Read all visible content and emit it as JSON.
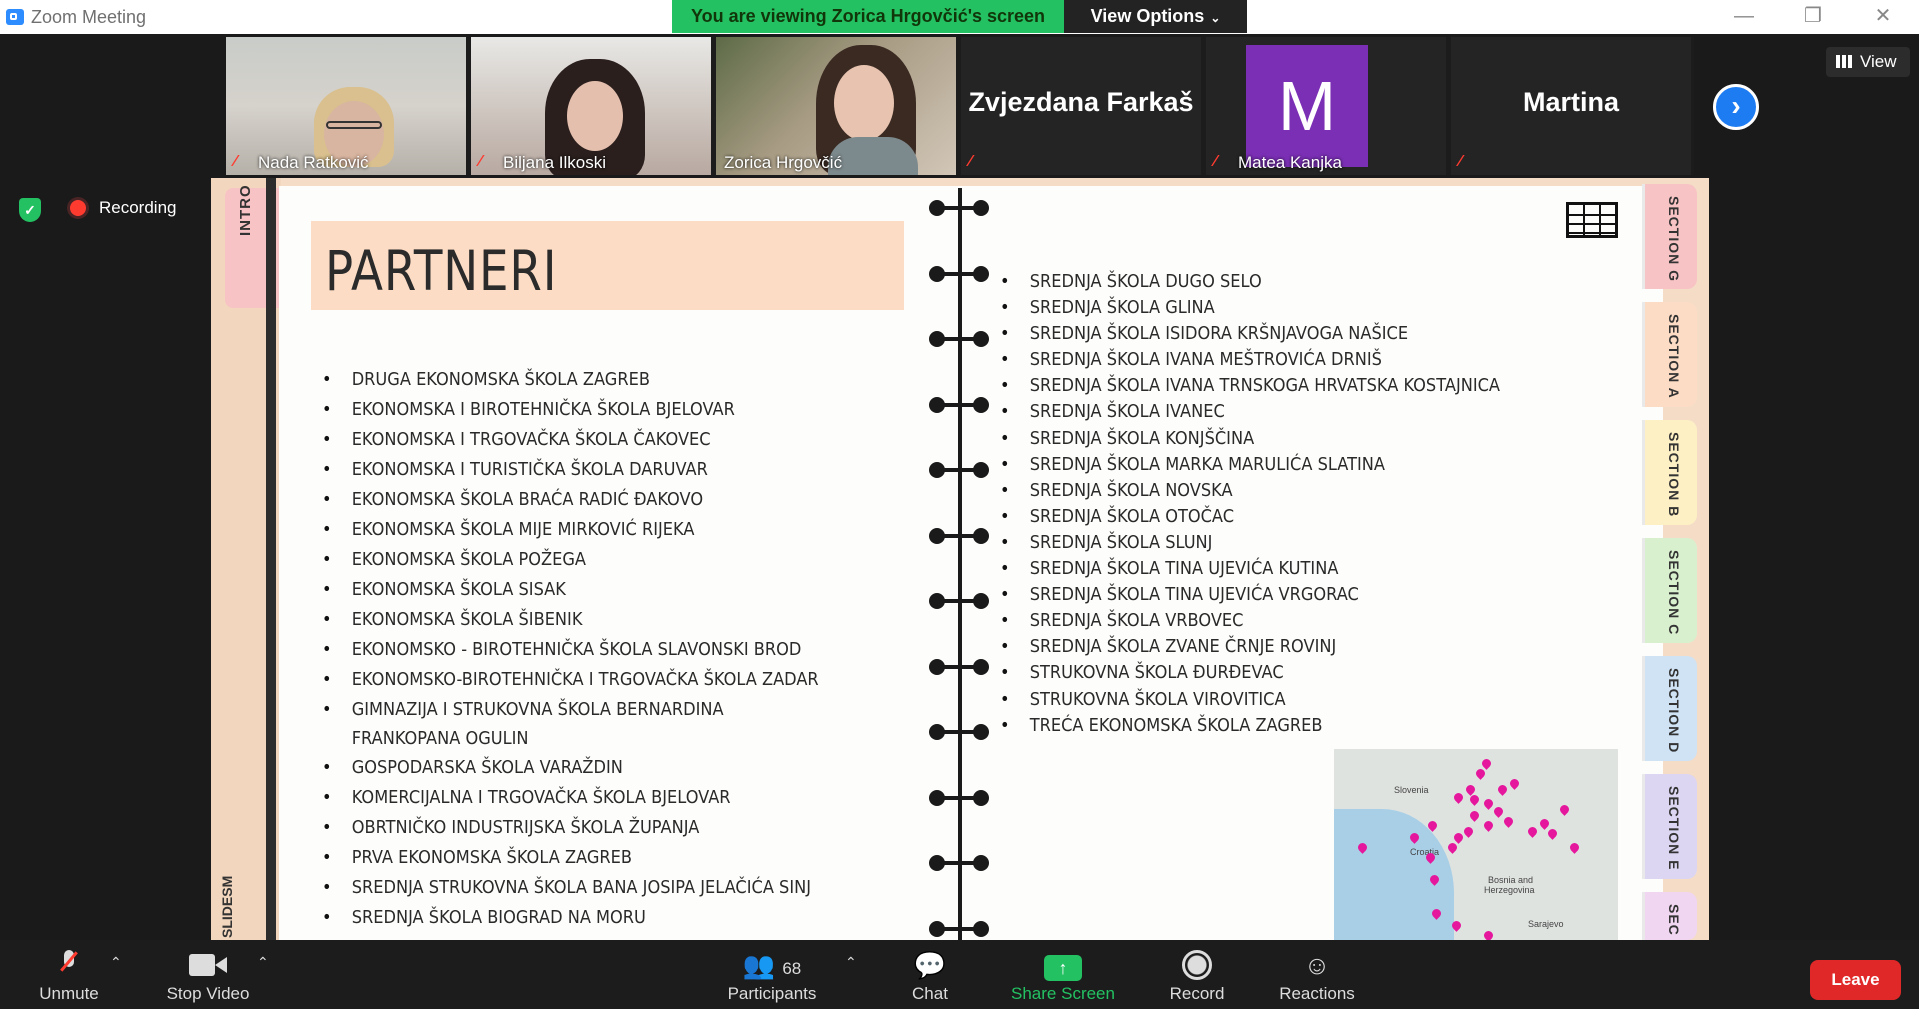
{
  "window": {
    "title": "Zoom Meeting",
    "minimize": "—",
    "maximize": "❐",
    "close": "✕"
  },
  "banner": {
    "viewing": "You are viewing Zorica Hrgovčić's screen",
    "view_options": "View Options",
    "caret": "⌄"
  },
  "participants_strip": [
    {
      "name": "Nada Ratković",
      "video": true,
      "muted": true
    },
    {
      "name": "Biljana Ilkoski",
      "video": true,
      "muted": true
    },
    {
      "name": "Zorica Hrgovčić",
      "video": true,
      "muted": false,
      "active_speaker": true
    },
    {
      "name": "Zvjezdana Farkaš",
      "video": false,
      "muted": true
    },
    {
      "name": "Matea Kanjka",
      "video": false,
      "avatar_letter": "M",
      "muted": true
    },
    {
      "name": "Martina",
      "video": false,
      "muted": true
    }
  ],
  "strip_next": "›",
  "view_button": "View",
  "status": {
    "shield": "✓",
    "recording": "Recording"
  },
  "slide": {
    "intro_tab": "INTRO",
    "side_label": "SLIDESM",
    "title": "PARTNERI",
    "left_list": [
      "DRUGA EKONOMSKA ŠKOLA ZAGREB",
      "EKONOMSKA I BIROTEHNIČKA ŠKOLA BJELOVAR",
      "EKONOMSKA I TRGOVAČKA ŠKOLA ČAKOVEC",
      "EKONOMSKA I TURISTIČKA ŠKOLA DARUVAR",
      "EKONOMSKA ŠKOLA BRAĆA RADIĆ ĐAKOVO",
      "EKONOMSKA ŠKOLA MIJE MIRKOVIĆ RIJEKA",
      "EKONOMSKA ŠKOLA POŽEGA",
      "EKONOMSKA ŠKOLA SISAK",
      "EKONOMSKA ŠKOLA ŠIBENIK",
      "EKONOMSKO - BIROTEHNIČKA ŠKOLA SLAVONSKI BROD",
      "EKONOMSKO-BIROTEHNIČKA I TRGOVAČKA ŠKOLA ZADAR",
      "GIMNAZIJA I STRUKOVNA ŠKOLA BERNARDINA FRANKOPANA OGULIN",
      "GOSPODARSKA ŠKOLA VARAŽDIN",
      "KOMERCIJALNA I TRGOVAČKA ŠKOLA BJELOVAR",
      "OBRTNIČKO INDUSTRIJSKA ŠKOLA ŽUPANJA",
      "PRVA EKONOMSKA ŠKOLA ZAGREB",
      "SREDNJA STRUKOVNA ŠKOLA BANA JOSIPA JELAČIĆA SINJ",
      "SREDNJA ŠKOLA BIOGRAD NA MORU"
    ],
    "right_list": [
      "SREDNJA ŠKOLA DUGO SELO",
      "SREDNJA ŠKOLA GLINA",
      "SREDNJA ŠKOLA ISIDORA KRŠNJAVOGA NAŠICE",
      "SREDNJA ŠKOLA IVANA MEŠTROVIĆA DRNIŠ",
      "SREDNJA ŠKOLA IVANA TRNSKOGA HRVATSKA KOSTAJNICA",
      "SREDNJA ŠKOLA IVANEC",
      "SREDNJA ŠKOLA KONJŠČINA",
      "SREDNJA ŠKOLA MARKA MARULIĆA SLATINA",
      "SREDNJA ŠKOLA NOVSKA",
      "SREDNJA ŠKOLA OTOČAC",
      "SREDNJA ŠKOLA SLUNJ",
      "SREDNJA ŠKOLA TINA UJEVIĆA KUTINA",
      "SREDNJA ŠKOLA TINA UJEVIĆA VRGORAC",
      "SREDNJA ŠKOLA VRBOVEC",
      "SREDNJA ŠKOLA ZVANE ČRNJE ROVINJ",
      "STRUKOVNA ŠKOLA ĐURĐEVAC",
      "STRUKOVNA ŠKOLA VIROVITICA",
      "TREĆA EKONOMSKA ŠKOLA ZAGREB"
    ],
    "section_tabs": [
      {
        "label": "SECTION G",
        "color": "#f7c3c4"
      },
      {
        "label": "SECTION A",
        "color": "#fcdcc5"
      },
      {
        "label": "SECTION B",
        "color": "#fdf0c4"
      },
      {
        "label": "SECTION C",
        "color": "#d9f0cf"
      },
      {
        "label": "SECTION D",
        "color": "#cfe3f5"
      },
      {
        "label": "SECTION E",
        "color": "#ddd6f2"
      },
      {
        "label": "SEC",
        "color": "#f0d6f0"
      }
    ],
    "map_labels": {
      "slovenia": "Slovenia",
      "croatia": "Croatia",
      "bosnia": "Bosnia and",
      "herzegovina": "Herzegovina",
      "sarajevo": "Sarajevo"
    }
  },
  "toolbar": {
    "unmute": "Unmute",
    "stop_video": "Stop Video",
    "participants": "Participants",
    "participants_count": "68",
    "chat": "Chat",
    "share_screen": "Share Screen",
    "share_arrow": "↑",
    "record": "Record",
    "reactions": "Reactions",
    "leave": "Leave",
    "caret": "⌃"
  }
}
